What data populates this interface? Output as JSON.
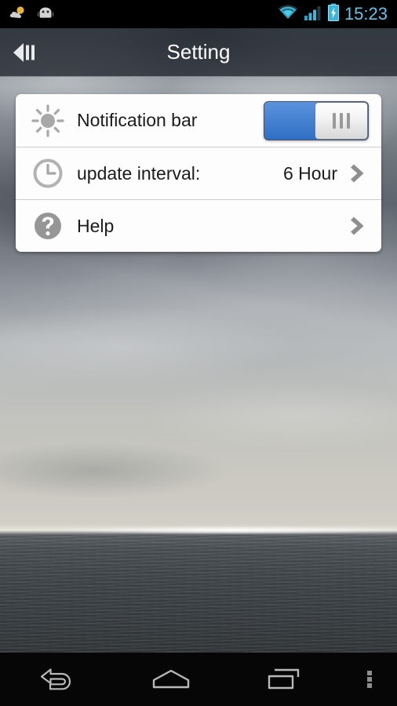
{
  "status_bar": {
    "time": "15:23",
    "time_color": "#5fc8e8",
    "background": "#000000",
    "left_icons": [
      {
        "name": "weather-cloud-notification-icon",
        "label": "weather notification"
      },
      {
        "name": "android-robot-icon",
        "label": "android system notification"
      }
    ],
    "right_icons": [
      {
        "name": "wifi-icon",
        "label": "wifi connected"
      },
      {
        "name": "cellular-signal-icon",
        "label": "signal strength"
      },
      {
        "name": "battery-charging-icon",
        "label": "battery charging"
      }
    ]
  },
  "action_bar": {
    "title": "Setting",
    "back_icon": "back-previous-icon",
    "background": "rgba(34,39,46,0.80)"
  },
  "settings": {
    "accent_color": "#3b7fd4",
    "rows": [
      {
        "id": "notification-bar",
        "icon": "sun-brightness-icon",
        "label": "Notification bar",
        "control": "toggle",
        "toggle_on": true,
        "value": ""
      },
      {
        "id": "update-interval",
        "icon": "clock-icon",
        "label": "update interval:",
        "control": "chevron",
        "value": "6 Hour"
      },
      {
        "id": "help",
        "icon": "help-question-icon",
        "label": "Help",
        "control": "chevron",
        "value": ""
      }
    ]
  },
  "nav_bar": {
    "background": "#060606",
    "buttons": [
      {
        "name": "nav-back-button",
        "label": "Back"
      },
      {
        "name": "nav-home-button",
        "label": "Home"
      },
      {
        "name": "nav-recents-button",
        "label": "Recent apps"
      },
      {
        "name": "nav-overflow-menu-button",
        "label": "More options"
      }
    ]
  },
  "wallpaper": {
    "description": "Photograph of an overcast sky with sun rays over a dark sea"
  }
}
